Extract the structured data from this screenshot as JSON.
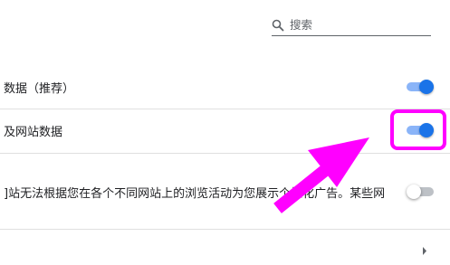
{
  "search": {
    "placeholder": "搜索",
    "icon": "search-icon"
  },
  "settings": [
    {
      "id": "row1",
      "label": "数据（推荐）",
      "enabled": true
    },
    {
      "id": "row2",
      "label": "及网站数据",
      "enabled": true
    },
    {
      "id": "row3",
      "label": "]站无法根据您在各个不同网站上的浏览活动为您展示个性化广告。某些网",
      "enabled": false
    }
  ],
  "colors": {
    "accent": "#1a73e8",
    "accent_track": "#8ab4f8",
    "highlight": "#ff00ff",
    "divider": "#e0e0e0"
  },
  "icons": {
    "next_row": "chevron-right-icon"
  }
}
